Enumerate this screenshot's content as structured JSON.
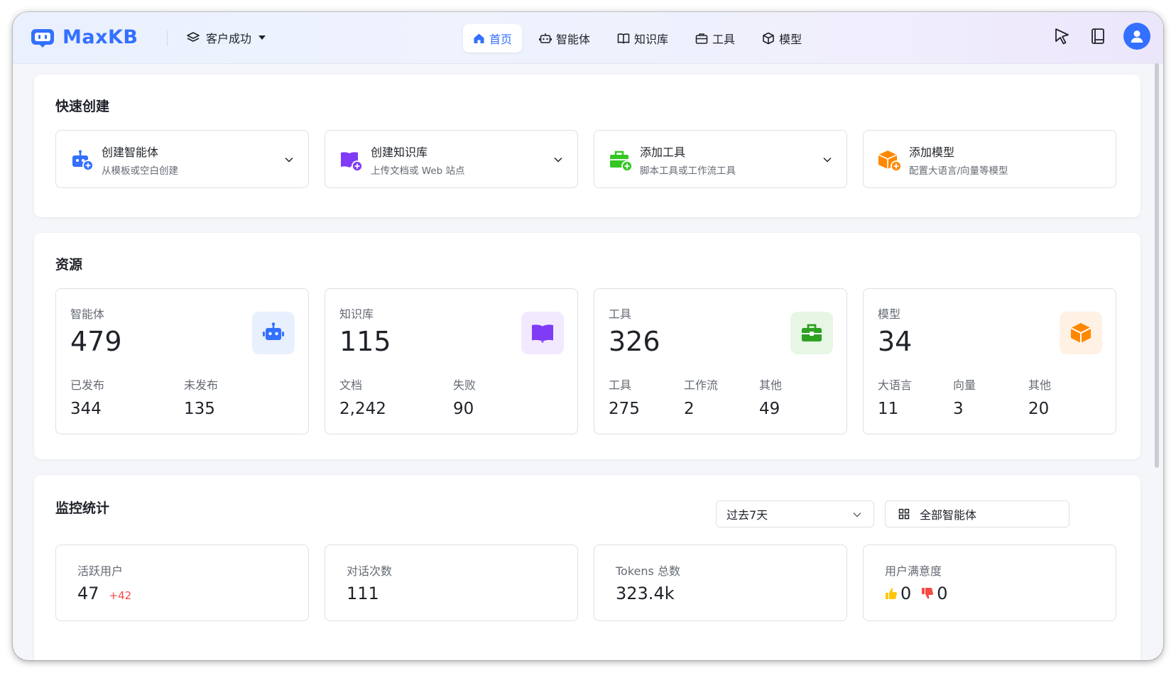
{
  "app": {
    "logo_text": "MaxKB"
  },
  "workspace": {
    "name": "客户成功"
  },
  "nav": [
    {
      "label": "首页",
      "icon": "home-icon",
      "active": true
    },
    {
      "label": "智能体",
      "icon": "robot-icon",
      "active": false
    },
    {
      "label": "知识库",
      "icon": "book-icon",
      "active": false
    },
    {
      "label": "工具",
      "icon": "toolbox-icon",
      "active": false
    },
    {
      "label": "模型",
      "icon": "cube-icon",
      "active": false
    }
  ],
  "quick_create": {
    "title": "快速创建",
    "items": [
      {
        "title": "创建智能体",
        "subtitle": "从模板或空白创建",
        "icon": "robot-add-icon",
        "color": "#3370ff",
        "has_dropdown": true
      },
      {
        "title": "创建知识库",
        "subtitle": "上传文档或 Web 站点",
        "icon": "book-add-icon",
        "color": "#7f3bf5",
        "has_dropdown": true
      },
      {
        "title": "添加工具",
        "subtitle": "脚本工具或工作流工具",
        "icon": "toolbox-add-icon",
        "color": "#34c724",
        "has_dropdown": true
      },
      {
        "title": "添加模型",
        "subtitle": "配置大语言/向量等模型",
        "icon": "cube-add-icon",
        "color": "#ff8800",
        "has_dropdown": false
      }
    ]
  },
  "resources": {
    "title": "资源",
    "items": [
      {
        "label": "智能体",
        "value": "479",
        "icon": "robot-icon",
        "color": "#3370ff",
        "bg": "#e8effd",
        "stats": [
          {
            "label": "已发布",
            "value": "344"
          },
          {
            "label": "未发布",
            "value": "135"
          }
        ]
      },
      {
        "label": "知识库",
        "value": "115",
        "icon": "book-icon",
        "color": "#7f3bf5",
        "bg": "#f1e9fe",
        "stats": [
          {
            "label": "文档",
            "value": "2,242"
          },
          {
            "label": "失败",
            "value": "90"
          }
        ]
      },
      {
        "label": "工具",
        "value": "326",
        "icon": "toolbox-icon",
        "color": "#2ea121",
        "bg": "#e7f6e5",
        "stats": [
          {
            "label": "工具",
            "value": "275"
          },
          {
            "label": "工作流",
            "value": "2"
          },
          {
            "label": "其他",
            "value": "49"
          }
        ]
      },
      {
        "label": "模型",
        "value": "34",
        "icon": "cube-icon",
        "color": "#ff8800",
        "bg": "#fff1e3",
        "stats": [
          {
            "label": "大语言",
            "value": "11"
          },
          {
            "label": "向量",
            "value": "3"
          },
          {
            "label": "其他",
            "value": "20"
          }
        ]
      }
    ]
  },
  "monitor": {
    "title": "监控统计",
    "period": "过去7天",
    "scope": "全部智能体",
    "metrics": [
      {
        "label": "活跃用户",
        "value": "47",
        "delta": "+42"
      },
      {
        "label": "对话次数",
        "value": "111"
      },
      {
        "label": "Tokens 总数",
        "value": "323.4k"
      },
      {
        "label": "用户满意度",
        "likes": "0",
        "dislikes": "0"
      }
    ]
  }
}
